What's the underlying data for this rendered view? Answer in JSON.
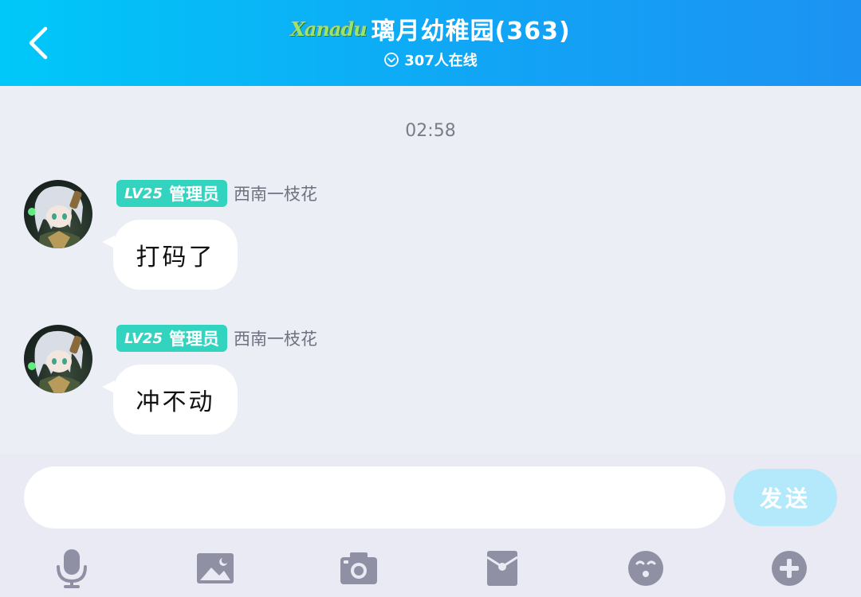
{
  "header": {
    "back_label": "back",
    "logo_text": "Xanadu",
    "title": "璃月幼稚园(363)",
    "online_status": "307人在线"
  },
  "chat": {
    "time": "02:58",
    "messages": [
      {
        "level": "LV25",
        "role": "管理员",
        "sender": "西南一枝花",
        "text": "打码了"
      },
      {
        "level": "LV25",
        "role": "管理员",
        "sender": "西南一枝花",
        "text": "冲不动"
      }
    ]
  },
  "composer": {
    "input_value": "",
    "send_label": "发送"
  },
  "toolbar": {
    "icons": [
      "microphone-icon",
      "image-icon",
      "camera-icon",
      "red-packet-icon",
      "emoji-icon",
      "plus-icon"
    ]
  },
  "colors": {
    "header_start": "#00c8f8",
    "header_end": "#1c92f2",
    "badge": "#32d4bf",
    "send_button": "#b3e9fb",
    "icon": "#8f90a4",
    "background": "#eceef6"
  }
}
